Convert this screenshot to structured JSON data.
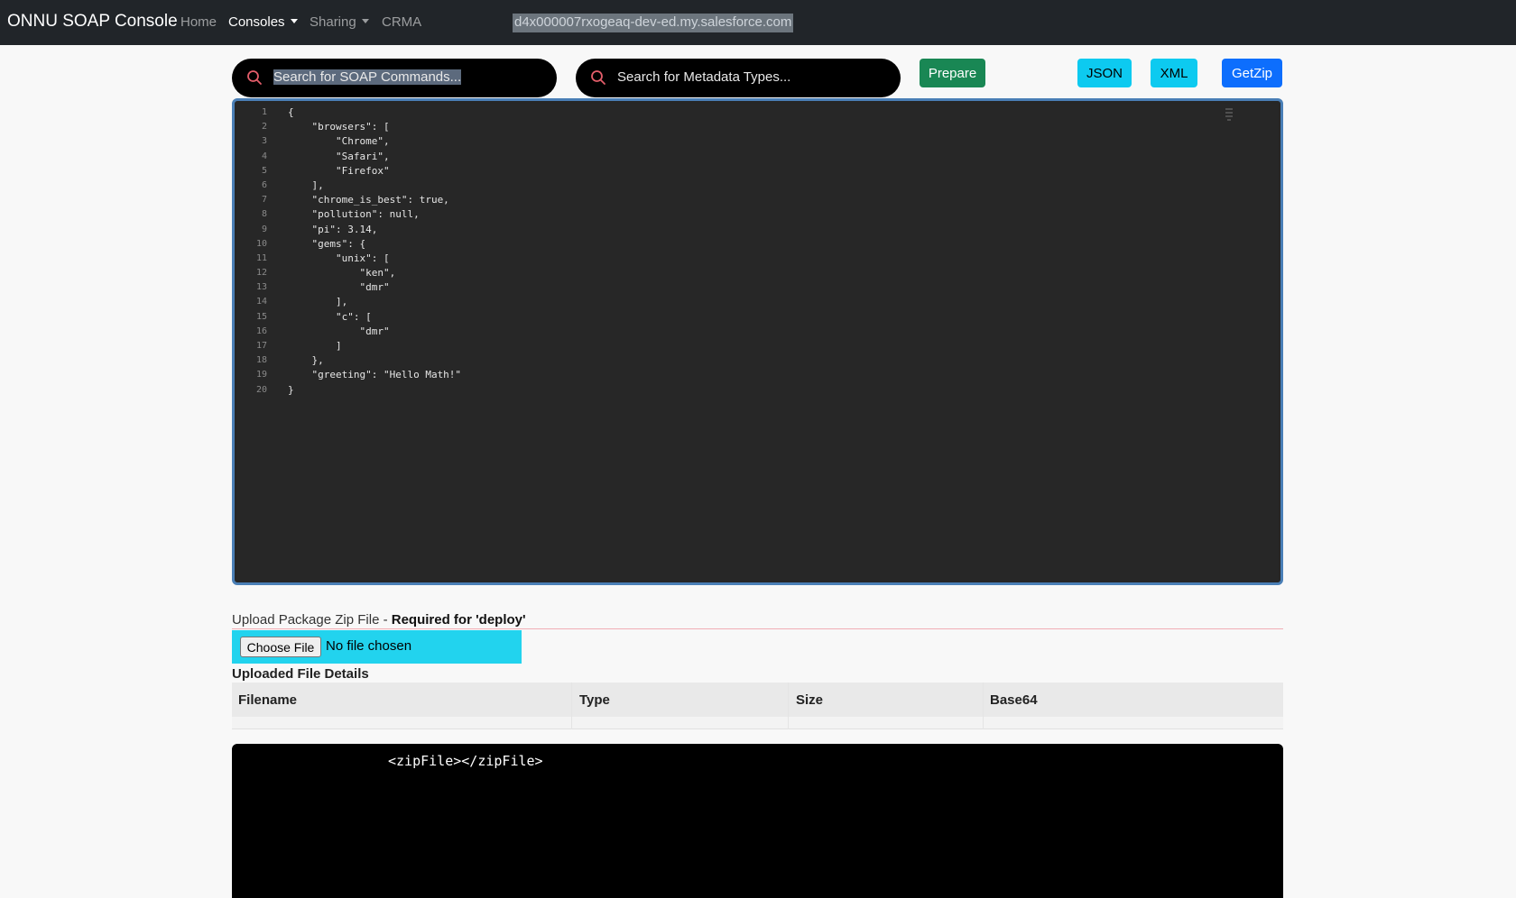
{
  "navbar": {
    "brand": "ONNU SOAP Console",
    "items": [
      {
        "label": "Home",
        "active": false,
        "dropdown": false
      },
      {
        "label": "Consoles",
        "active": true,
        "dropdown": true
      },
      {
        "label": "Sharing",
        "active": false,
        "dropdown": true
      },
      {
        "label": "CRMA",
        "active": false,
        "dropdown": false
      }
    ],
    "org_url": "d4x000007rxogeaq-dev-ed.my.salesforce.com"
  },
  "toolbar": {
    "soap_search": {
      "placeholder": "Search for SOAP Commands...",
      "icon": "search-icon"
    },
    "metadata_search": {
      "placeholder": "Search for Metadata Types...",
      "icon": "search-icon"
    },
    "prepare_label": "Prepare",
    "json_label": "JSON",
    "xml_label": "XML",
    "getzip_label": "GetZip",
    "colors": {
      "prepare": "#198754",
      "json": "#0dcaf0",
      "xml": "#0dcaf0",
      "getzip": "#0d6efd"
    }
  },
  "editor": {
    "line_numbers": [
      "1",
      "2",
      "3",
      "4",
      "5",
      "6",
      "7",
      "8",
      "9",
      "10",
      "11",
      "12",
      "13",
      "14",
      "15",
      "16",
      "17",
      "18",
      "19",
      "20"
    ],
    "lines": [
      "{",
      "    \"browsers\": [",
      "        \"Chrome\",",
      "        \"Safari\",",
      "        \"Firefox\"",
      "    ],",
      "    \"chrome_is_best\": true,",
      "    \"pollution\": null,",
      "    \"pi\": 3.14,",
      "    \"gems\": {",
      "        \"unix\": [",
      "            \"ken\",",
      "            \"dmr\"",
      "        ],",
      "        \"c\": [",
      "            \"dmr\"",
      "        ]",
      "    },",
      "    \"greeting\": \"Hello Math!\"",
      "}"
    ]
  },
  "upload": {
    "label_prefix": "Upload Package Zip File - ",
    "label_required": "Required for 'deploy'",
    "choose_file_label": "Choose File",
    "no_file_text": "No file chosen"
  },
  "file_details": {
    "title": "Uploaded File Details",
    "columns": [
      "Filename",
      "Type",
      "Size",
      "Base64"
    ]
  },
  "xml_output": {
    "text": "<zipFile></zipFile>"
  }
}
